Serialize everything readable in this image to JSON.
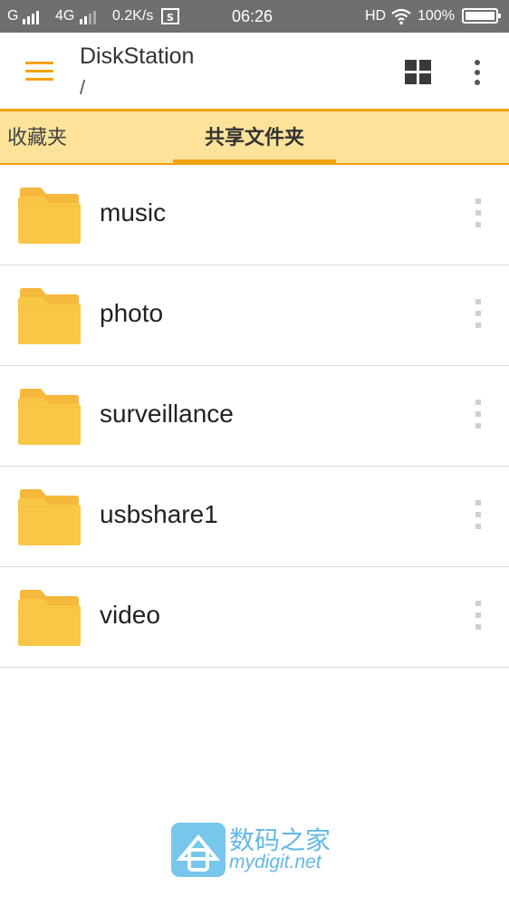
{
  "status_bar": {
    "carrier1": "G",
    "network2": "4G",
    "speed": "0.2K/s",
    "time": "06:26",
    "hd": "HD",
    "battery": "100%",
    "icons": [
      "signal-icon",
      "data-saver-icon",
      "wifi-icon",
      "battery-icon"
    ]
  },
  "appbar": {
    "title": "DiskStation",
    "path": "/",
    "icons": [
      "menu-icon",
      "grid-view-icon",
      "more-vert-icon"
    ]
  },
  "tabs": [
    {
      "label": "收藏夹",
      "active": false
    },
    {
      "label": "共享文件夹",
      "active": true
    }
  ],
  "folders": [
    {
      "name": "music"
    },
    {
      "name": "photo"
    },
    {
      "name": "surveillance"
    },
    {
      "name": "usbshare1"
    },
    {
      "name": "video"
    }
  ],
  "watermark": {
    "cn": "数码之家",
    "en": "mydigit.net"
  },
  "colors": {
    "accent": "#f3a20f",
    "tab_bg": "#fde29a",
    "folder": "#f9c746",
    "status_bar": "#6f6f6f"
  }
}
